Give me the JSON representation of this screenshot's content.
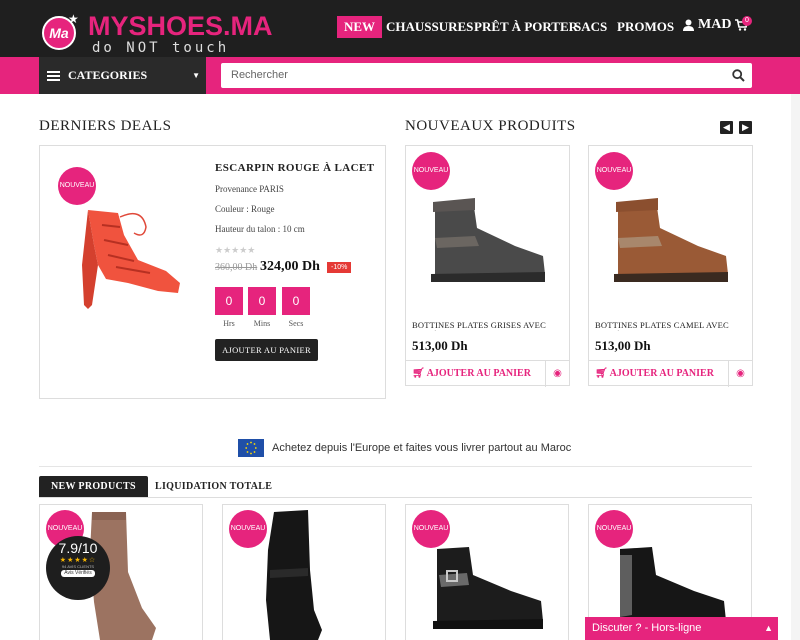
{
  "header": {
    "logo_badge": "Ma",
    "logo_name": "MYSHOES.MA",
    "logo_tagline": "do NOT touch",
    "nav": [
      "NEW",
      "CHAUSSURES",
      "PRÊT À PORTER",
      "SACS",
      "PROMOS"
    ],
    "currency": "MAD",
    "cart_count": "0"
  },
  "toolbar": {
    "categories_label": "CATEGORIES",
    "search_placeholder": "Rechercher"
  },
  "deals": {
    "title": "DERNIERS DEALS",
    "badge": "NOUVEAU",
    "product_name": "ESCARPIN ROUGE À LACET",
    "details": [
      "Provenance PARIS",
      "Couleur : Rouge",
      "Hauteur du talon : 10 cm"
    ],
    "old_price": "360,00 Dh",
    "price": "324,00 Dh",
    "discount": "-10%",
    "countdown": [
      {
        "value": "0",
        "label": "Hrs"
      },
      {
        "value": "0",
        "label": "Mins"
      },
      {
        "value": "0",
        "label": "Secs"
      }
    ],
    "add_to_cart": "AJOUTER AU PANIER"
  },
  "new_products": {
    "title": "NOUVEAUX PRODUITS",
    "items": [
      {
        "badge": "NOUVEAU",
        "name": "BOTTINES PLATES GRISES AVEC EMPIÈCEMENTS DE",
        "price": "513,00 Dh",
        "add_to_cart": "AJOUTER AU PANIER"
      },
      {
        "badge": "NOUVEAU",
        "name": "BOTTINES PLATES CAMEL AVEC EMPIÈCEMENTS DE",
        "price": "513,00 Dh",
        "add_to_cart": "AJOUTER AU PANIER"
      }
    ]
  },
  "banner": {
    "text": "Achetez depuis l'Europe et faites vous livrer partout au Maroc"
  },
  "tabs": [
    "NEW PRODUCTS",
    "LIQUIDATION TOTALE"
  ],
  "grid": {
    "badges": [
      "NOUVEAU",
      "NOUVEAU",
      "NOUVEAU",
      "NOUVEAU"
    ]
  },
  "rating_widget": {
    "score": "7.9/10",
    "stars": "★★★★☆",
    "subtitle": "94 AVIS CLIENTS",
    "source": "Avis Vérifiés"
  },
  "chat": {
    "label": "Discuter ? - Hors-ligne"
  },
  "colors": {
    "accent": "#e6247d",
    "dark": "#1f1f1f"
  }
}
